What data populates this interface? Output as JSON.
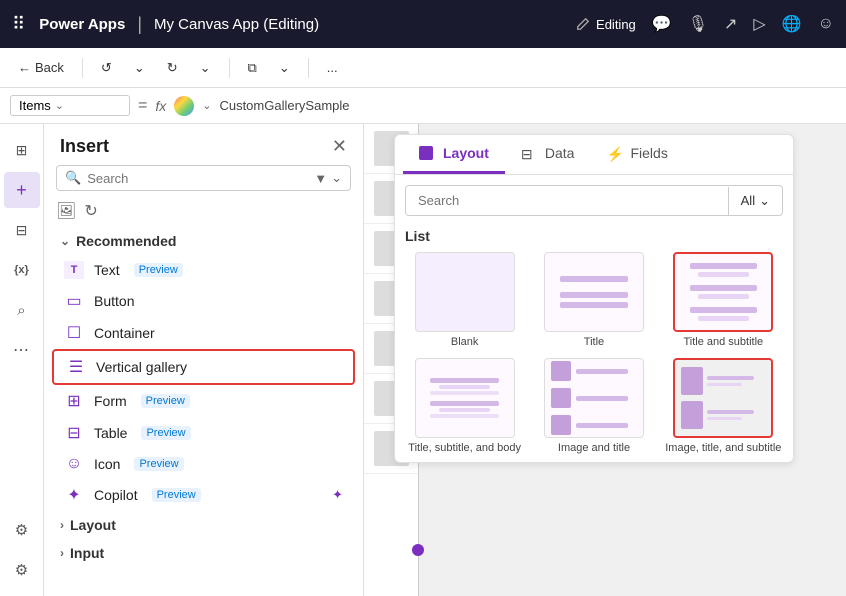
{
  "topbar": {
    "dots": "⠿",
    "appName": "Power Apps",
    "separator": "|",
    "canvasName": "My Canvas App (Editing)",
    "editing": "Editing",
    "icons": [
      "🌐",
      "☺"
    ]
  },
  "toolbar": {
    "back": "Back",
    "undo": "↺",
    "redo": "↻",
    "copy": "⧉",
    "copyDown": "⌄",
    "more": "...",
    "editingLabel": "Editing",
    "commentIcon": "💬",
    "shareIcon": "↗",
    "playIcon": "▷"
  },
  "formulabar": {
    "label": "Items",
    "equals": "=",
    "fx": "fx",
    "value": "CustomGallerySample"
  },
  "iconbar": {
    "items": [
      {
        "name": "layers-icon",
        "icon": "⊞",
        "active": false
      },
      {
        "name": "add-icon",
        "icon": "+",
        "active": false
      },
      {
        "name": "grid-icon",
        "icon": "⊟",
        "active": false
      },
      {
        "name": "variable-icon",
        "icon": "{x}",
        "active": false
      },
      {
        "name": "search-icon",
        "icon": "⌕",
        "active": false
      },
      {
        "name": "more-icon",
        "icon": "⋯",
        "active": false
      }
    ],
    "bottomItems": [
      {
        "name": "settings-icon",
        "icon": "⚙",
        "active": false
      },
      {
        "name": "gear2-icon",
        "icon": "⚙",
        "active": false
      }
    ]
  },
  "insertPanel": {
    "title": "Insert",
    "searchPlaceholder": "Search",
    "sections": {
      "recommended": {
        "label": "Recommended",
        "items": [
          {
            "name": "Text",
            "icon": "T",
            "badge": "Preview"
          },
          {
            "name": "Button",
            "icon": "▭",
            "badge": null
          },
          {
            "name": "Container",
            "icon": "☐",
            "badge": null
          },
          {
            "name": "Vertical gallery",
            "icon": "☰",
            "badge": null,
            "highlighted": true
          },
          {
            "name": "Form",
            "icon": "⊞",
            "badge": "Preview"
          },
          {
            "name": "Table",
            "icon": "⊟",
            "badge": "Preview"
          },
          {
            "name": "Icon",
            "icon": "☺",
            "badge": "Preview"
          },
          {
            "name": "Copilot",
            "icon": "✦",
            "badge": "Preview"
          }
        ]
      },
      "layout": {
        "label": "Layout"
      },
      "input": {
        "label": "Input"
      }
    }
  },
  "layoutPanel": {
    "tabs": [
      {
        "label": "Layout",
        "active": true
      },
      {
        "label": "Data",
        "active": false
      },
      {
        "label": "Fields",
        "active": false
      }
    ],
    "searchPlaceholder": "Search",
    "searchAllLabel": "All",
    "listLabel": "List",
    "galleryItems": [
      {
        "label": "Blank",
        "type": "blank",
        "selected": false
      },
      {
        "label": "Title",
        "type": "title",
        "selected": false
      },
      {
        "label": "Title and subtitle",
        "type": "title-sub",
        "selected": false
      },
      {
        "label": "Title, subtitle, and body",
        "type": "title-sub-body",
        "selected": false
      },
      {
        "label": "Image and title",
        "type": "image-title",
        "selected": false
      },
      {
        "label": "Image, title, and subtitle",
        "type": "image-title-sub",
        "selected": true
      }
    ]
  }
}
